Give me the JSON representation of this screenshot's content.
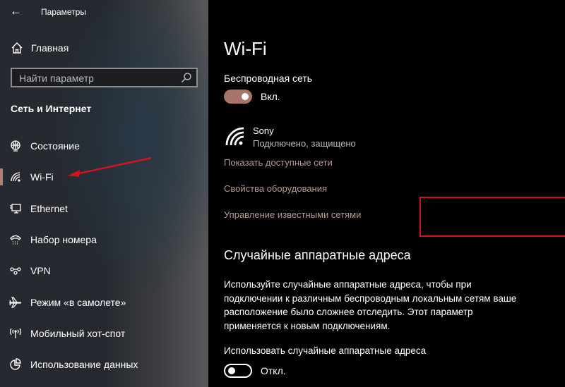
{
  "window": {
    "title": "Параметры",
    "back_icon": "back-arrow-icon"
  },
  "sidebar": {
    "home_label": "Главная",
    "search_placeholder": "Найти параметр",
    "section_title": "Сеть и Интернет",
    "items": [
      {
        "label": "Состояние",
        "icon": "globe-status-icon",
        "selected": false
      },
      {
        "label": "Wi-Fi",
        "icon": "wifi-icon",
        "selected": true
      },
      {
        "label": "Ethernet",
        "icon": "ethernet-icon",
        "selected": false
      },
      {
        "label": "Набор номера",
        "icon": "dial-up-icon",
        "selected": false
      },
      {
        "label": "VPN",
        "icon": "vpn-icon",
        "selected": false
      },
      {
        "label": "Режим «в самолете»",
        "icon": "airplane-icon",
        "selected": false
      },
      {
        "label": "Мобильный хот-спот",
        "icon": "hotspot-icon",
        "selected": false
      },
      {
        "label": "Использование данных",
        "icon": "data-usage-icon",
        "selected": false
      }
    ]
  },
  "main": {
    "title": "Wi-Fi",
    "wireless": {
      "label": "Беспроводная сеть",
      "toggle_on": true,
      "state_label": "Вкл."
    },
    "connected_network": {
      "name": "Sony",
      "status": "Подключено, защищено"
    },
    "links": {
      "show_networks": "Показать доступные сети",
      "hardware_properties": "Свойства оборудования",
      "manage_known": "Управление известными сетями"
    },
    "random_mac": {
      "heading": "Случайные аппаратные адреса",
      "description": "Используйте случайные аппаратные адреса, чтобы при подключении к различным беспроводным локальным сетям ваше расположение было сложнее отследить. Этот параметр применяется к новым подключениям.",
      "toggle_label": "Использовать случайные аппаратные адреса",
      "toggle_on": false,
      "state_label": "Откл."
    }
  },
  "annotations": {
    "arrow_color": "#d4141b",
    "box_color": "#d4141b"
  },
  "colors": {
    "accent": "#a87568",
    "link": "#b79a92"
  }
}
